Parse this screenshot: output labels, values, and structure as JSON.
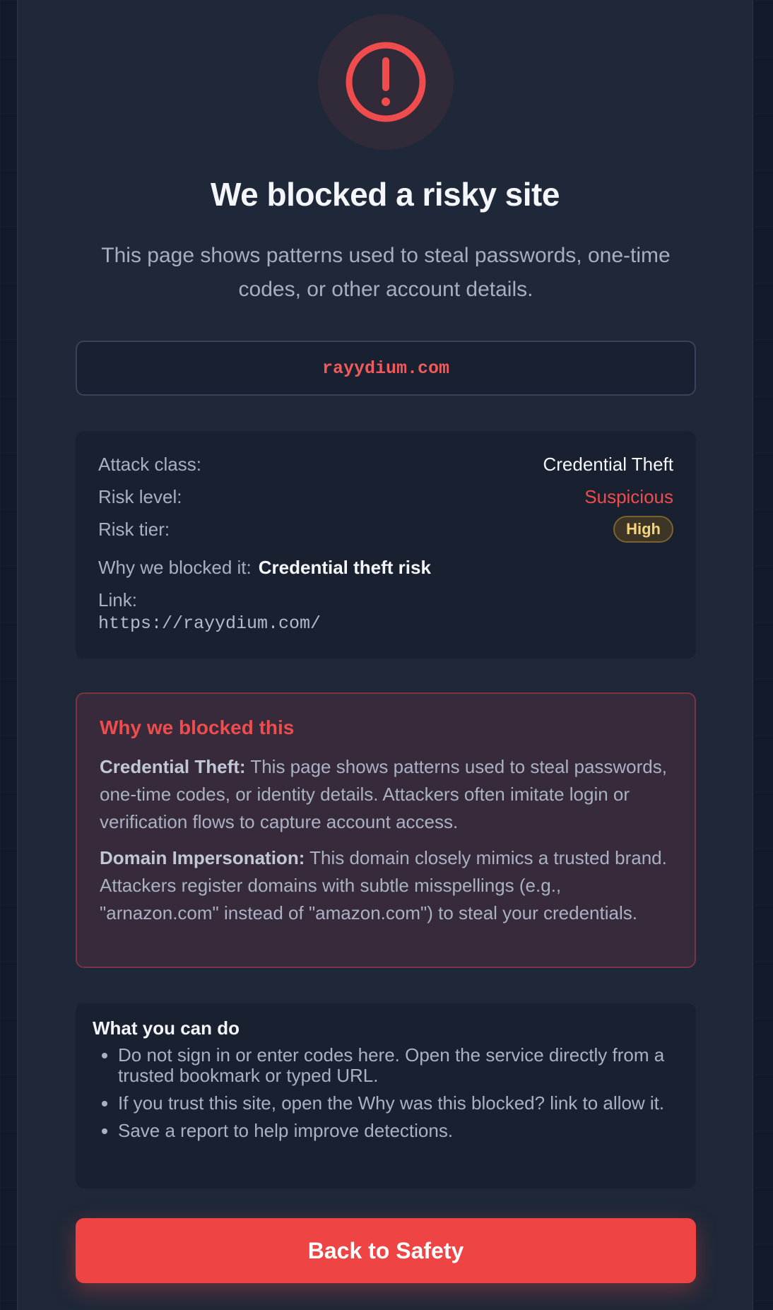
{
  "header": {
    "icon": "alert-circle-icon",
    "title": "We blocked a risky site",
    "subtitle": "This page shows patterns used to steal passwords, one-time codes, or other account details."
  },
  "domain": "rayydium.com",
  "details": {
    "attack_class_label": "Attack class:",
    "attack_class_value": "Credential Theft",
    "risk_level_label": "Risk level:",
    "risk_level_value": "Suspicious",
    "risk_tier_label": "Risk tier:",
    "risk_tier_value": "High",
    "why_label": "Why we blocked it:",
    "why_value": "Credential theft risk",
    "link_label": "Link:",
    "link_value": "https://rayydium.com/"
  },
  "reasons": {
    "title": "Why we blocked this",
    "items": [
      {
        "heading": "Credential Theft:",
        "text": " This page shows patterns used to steal passwords, one-time codes, or identity details. Attackers often imitate login or verification flows to capture account access."
      },
      {
        "heading": "Domain Impersonation:",
        "text": " This domain closely mimics a trusted brand. Attackers register domains with subtle misspellings (e.g., \"arnazon.com\" instead of \"amazon.com\") to steal your credentials."
      }
    ]
  },
  "actions": {
    "title": "What you can do",
    "items": [
      "Do not sign in or enter codes here. Open the service directly from a trusted bookmark or typed URL.",
      "If you trust this site, open the Why was this blocked? link to allow it.",
      "Save a report to help improve detections."
    ]
  },
  "back_button": "Back to Safety",
  "colors": {
    "danger": "#ef4444",
    "warning_badge": "#f6d37a",
    "background": "#1f2838"
  }
}
